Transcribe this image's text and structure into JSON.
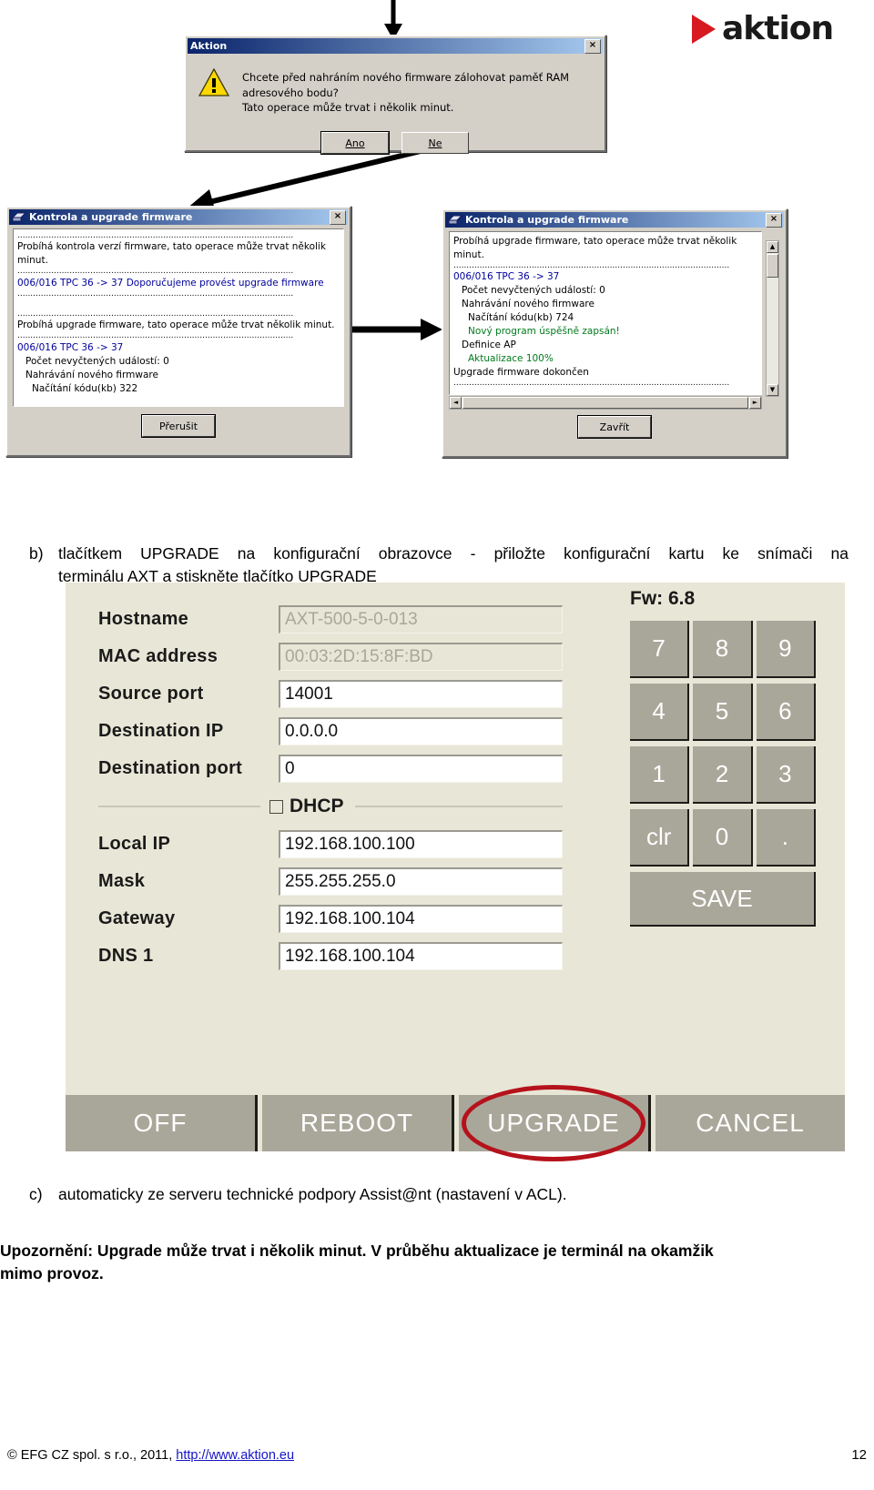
{
  "logo": {
    "text": "aktion",
    "triangle_color": "#d71920",
    "text_color": "#1a1a1a"
  },
  "dialog_aktion": {
    "title": "Aktion",
    "icon": "warning-icon",
    "close_label": "×",
    "message_line1": "Chcete před nahráním nového firmware zálohovat paměť RAM adresového bodu?",
    "message_line2": "Tato operace může trvat i několik minut.",
    "yes_label": "Ano",
    "no_label": "Ne"
  },
  "dialog_firmware_left": {
    "title": "Kontrola a upgrade firmware",
    "close_label": "×",
    "separator": "..........................................................................................................",
    "log": [
      {
        "text": "Probíhá kontrola verzí firmware, tato operace může trvat několik minut.",
        "color": "black",
        "indent": 0
      },
      {
        "text": "006/016 TPC 36 -> 37 Doporučujeme provést upgrade firmware",
        "color": "blue",
        "indent": 0
      },
      {
        "text": "Probíhá upgrade firmware, tato operace může trvat několik minut.",
        "color": "black",
        "indent": 0
      },
      {
        "text": "006/016 TPC 36 -> 37",
        "color": "blue",
        "indent": 0
      },
      {
        "text": "Počet nevyčtených událostí: 0",
        "color": "black",
        "indent": 1
      },
      {
        "text": "Nahrávání nového firmware",
        "color": "black",
        "indent": 1
      },
      {
        "text": "Načítání kódu(kb) 322",
        "color": "black",
        "indent": 2
      }
    ],
    "button_label": "Přerušit"
  },
  "dialog_firmware_right": {
    "title": "Kontrola a upgrade firmware",
    "close_label": "×",
    "separator": "..........................................................................................................",
    "log": [
      {
        "text": "Probíhá upgrade firmware, tato operace může trvat několik minut.",
        "color": "black",
        "indent": 0
      },
      {
        "text": "006/016 TPC 36 -> 37",
        "color": "blue",
        "indent": 0
      },
      {
        "text": "Počet nevyčtených událostí: 0",
        "color": "black",
        "indent": 1
      },
      {
        "text": "Nahrávání nového firmware",
        "color": "black",
        "indent": 1
      },
      {
        "text": "Načítání kódu(kb) 724",
        "color": "black",
        "indent": 2
      },
      {
        "text": "Nový program úspěšně zapsán!",
        "color": "green",
        "indent": 2
      },
      {
        "text": "Definice AP",
        "color": "black",
        "indent": 1
      },
      {
        "text": "Aktualizace 100%",
        "color": "green",
        "indent": 2
      },
      {
        "text": "Upgrade firmware dokončen",
        "color": "black",
        "indent": 0
      }
    ],
    "button_label": "Zavřít",
    "scroll_up": "▲",
    "scroll_down": "▼",
    "scroll_left": "◄",
    "scroll_right": "►"
  },
  "step_b": {
    "marker": "b)",
    "line1": "tlačítkem UPGRADE na konfigurační obrazovce - přiložte konfigurační kartu ke snímači na",
    "line2": "terminálu AXT a stiskněte tlačítko UPGRADE"
  },
  "step_c": {
    "marker": "c)",
    "text": "automaticky ze serveru technické podpory Assist@nt (nastavení v ACL)."
  },
  "warning": {
    "line1": "Upozornění: Upgrade může trvat i několik minut. V průběhu aktualizace je terminál na okamžik",
    "line2": "mimo provoz."
  },
  "axt_terminal": {
    "fw_label": "Fw: 6.8",
    "fields": [
      {
        "label": "Hostname",
        "value": "AXT-500-5-0-013",
        "readonly": true
      },
      {
        "label": "MAC address",
        "value": "00:03:2D:15:8F:BD",
        "readonly": true
      },
      {
        "label": "Source port",
        "value": "14001",
        "readonly": false
      },
      {
        "label": "Destination IP",
        "value": "0.0.0.0",
        "readonly": false
      },
      {
        "label": "Destination port",
        "value": "0",
        "readonly": false
      }
    ],
    "dhcp": {
      "label": "DHCP",
      "checked": false
    },
    "fields2": [
      {
        "label": "Local IP",
        "value": "192.168.100.100",
        "readonly": false
      },
      {
        "label": "Mask",
        "value": "255.255.255.0",
        "readonly": false
      },
      {
        "label": "Gateway",
        "value": "192.168.100.104",
        "readonly": false
      },
      {
        "label": "DNS 1",
        "value": "192.168.100.104",
        "readonly": false
      }
    ],
    "keypad": [
      [
        "7",
        "8",
        "9"
      ],
      [
        "4",
        "5",
        "6"
      ],
      [
        "1",
        "2",
        "3"
      ],
      [
        "clr",
        "0",
        "."
      ]
    ],
    "save_label": "SAVE",
    "bottom_buttons": [
      {
        "label": "OFF",
        "highlighted": false
      },
      {
        "label": "REBOOT",
        "highlighted": false
      },
      {
        "label": "UPGRADE",
        "highlighted": true
      },
      {
        "label": "CANCEL",
        "highlighted": false
      }
    ],
    "highlight_color": "#b5121b"
  },
  "footer": {
    "copyright": "© EFG CZ spol. s r.o., 2011, ",
    "url": "http://www.aktion.eu",
    "page": "12"
  }
}
